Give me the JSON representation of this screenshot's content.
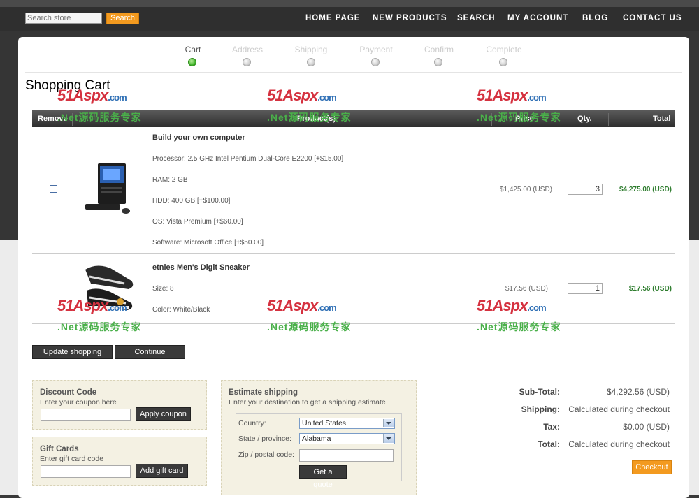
{
  "header": {
    "search_placeholder": "Search store",
    "search_button": "Search",
    "nav": [
      "HOME PAGE",
      "NEW PRODUCTS",
      "SEARCH",
      "MY ACCOUNT",
      "BLOG",
      "CONTACT US"
    ]
  },
  "steps": [
    "Cart",
    "Address",
    "Shipping",
    "Payment",
    "Confirm",
    "Complete"
  ],
  "page_title": "Shopping Cart",
  "table": {
    "headers": [
      "Remove",
      "Product(s)",
      "Price",
      "Qty.",
      "Total"
    ],
    "rows": [
      {
        "name": "Build your own computer",
        "attributes": [
          "Processor: 2.5 GHz Intel Pentium Dual-Core E2200 [+$15.00]",
          "RAM: 2 GB",
          "HDD: 400 GB [+$100.00]",
          "OS: Vista Premium [+$60.00]",
          "Software: Microsoft Office [+$50.00]"
        ],
        "price": "$1,425.00 (USD)",
        "qty": "3",
        "total": "$4,275.00 (USD)"
      },
      {
        "name": "etnies Men's Digit Sneaker",
        "attributes": [
          "Size: 8",
          "Color: White/Black"
        ],
        "price": "$17.56 (USD)",
        "qty": "1",
        "total": "$17.56 (USD)"
      }
    ]
  },
  "buttons": {
    "update": "Update shopping cart",
    "continue": "Continue shopping"
  },
  "discount": {
    "title": "Discount Code",
    "hint": "Enter your coupon here",
    "button": "Apply coupon"
  },
  "giftcard": {
    "title": "Gift Cards",
    "hint": "Enter gift card code",
    "button": "Add gift card"
  },
  "shipping": {
    "title": "Estimate shipping",
    "hint": "Enter your destination to get a shipping estimate",
    "country_label": "Country:",
    "country_value": "United States",
    "state_label": "State / province:",
    "state_value": "Alabama",
    "zip_label": "Zip / postal code:",
    "button": "Get a quote"
  },
  "totals": {
    "subtotal_label": "Sub-Total:",
    "subtotal_value": "$4,292.56 (USD)",
    "shipping_label": "Shipping:",
    "shipping_value": "Calculated during checkout",
    "tax_label": "Tax:",
    "tax_value": "$0.00 (USD)",
    "total_label": "Total:",
    "total_value": "Calculated during checkout",
    "checkout": "Checkout"
  },
  "watermark": {
    "logo": "51Aspx",
    "domain": ".com",
    "tagline": ".Net源码服务专家"
  },
  "colors": {
    "accent": "#f39a1f",
    "total_green": "#2f7d2f",
    "step_active": "#43b52d"
  }
}
